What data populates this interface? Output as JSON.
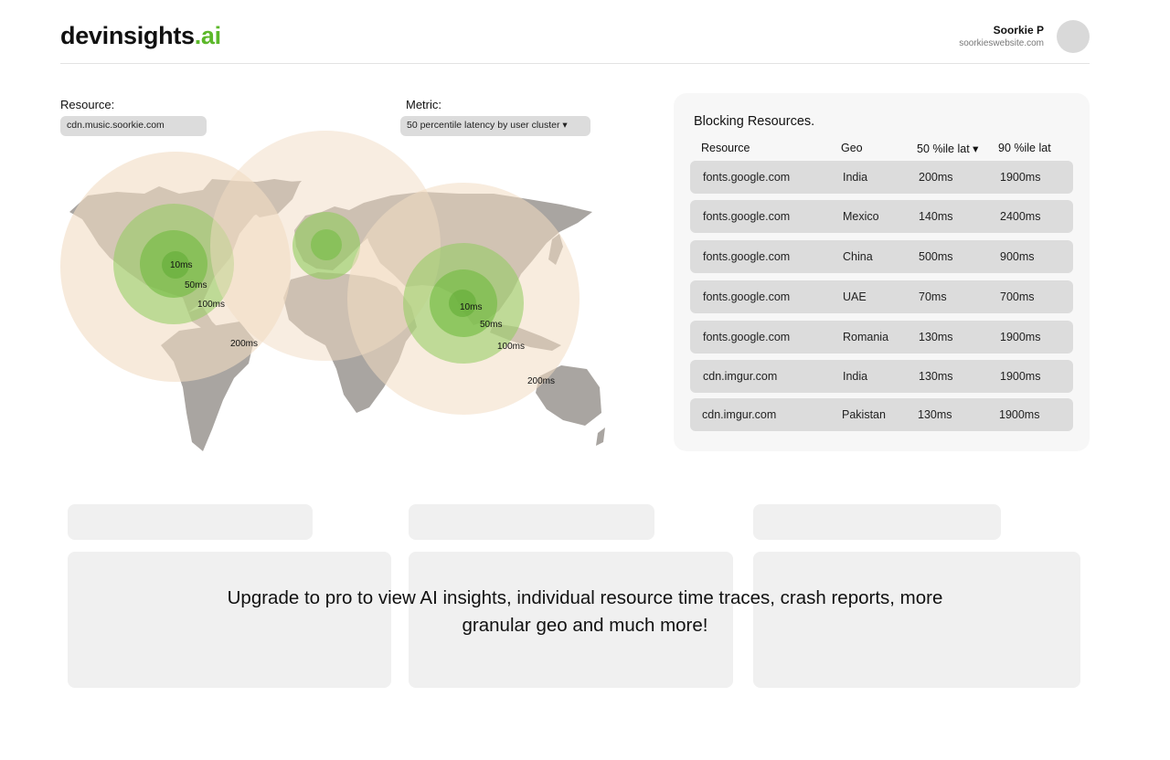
{
  "brand": {
    "name": "devinsights",
    "accent": ".ai",
    "accent_color": "#5cb82a"
  },
  "user": {
    "name": "Soorkie P",
    "website": "soorkieswebsite.com"
  },
  "resource": {
    "label": "Resource:",
    "value": "cdn.music.soorkie.com"
  },
  "metric": {
    "label": "Metric:",
    "value": "50 percentile latency by user cluster ▾"
  },
  "map": {
    "clusters": [
      {
        "region": "north-america",
        "labels": [
          "10ms",
          "50ms",
          "100ms",
          "200ms"
        ]
      },
      {
        "region": "europe",
        "labels": []
      },
      {
        "region": "asia",
        "labels": [
          "10ms",
          "50ms",
          "100ms",
          "200ms"
        ]
      }
    ],
    "colors": {
      "land": "#a9a5a1",
      "outer": "#f2dcc3",
      "green_light": "#b6df8f",
      "green_mid": "#8fcc5c",
      "green_dark": "#6fbb3e"
    }
  },
  "blocking": {
    "title": "Blocking Resources.",
    "headers": {
      "resource": "Resource",
      "geo": "Geo",
      "p50": "50 %ile lat ▾",
      "p90": "90 %ile lat"
    },
    "rows": [
      {
        "resource": "fonts.google.com",
        "geo": "India",
        "p50": "200ms",
        "p90": "1900ms"
      },
      {
        "resource": "fonts.google.com",
        "geo": "Mexico",
        "p50": "140ms",
        "p90": "2400ms"
      },
      {
        "resource": "fonts.google.com",
        "geo": "China",
        "p50": "500ms",
        "p90": "900ms"
      },
      {
        "resource": "fonts.google.com",
        "geo": "UAE",
        "p50": "70ms",
        "p90": "700ms"
      },
      {
        "resource": "fonts.google.com",
        "geo": "Romania",
        "p50": "130ms",
        "p90": "1900ms"
      },
      {
        "resource": "cdn.imgur.com",
        "geo": "India",
        "p50": "130ms",
        "p90": "1900ms"
      },
      {
        "resource": "cdn.imgur.com",
        "geo": "Pakistan",
        "p50": "130ms",
        "p90": "1900ms"
      }
    ]
  },
  "upgrade": {
    "line1": "Upgrade to pro to view AI insights, individual resource time traces,  crash reports, more",
    "line2": "granular geo and much more!"
  }
}
